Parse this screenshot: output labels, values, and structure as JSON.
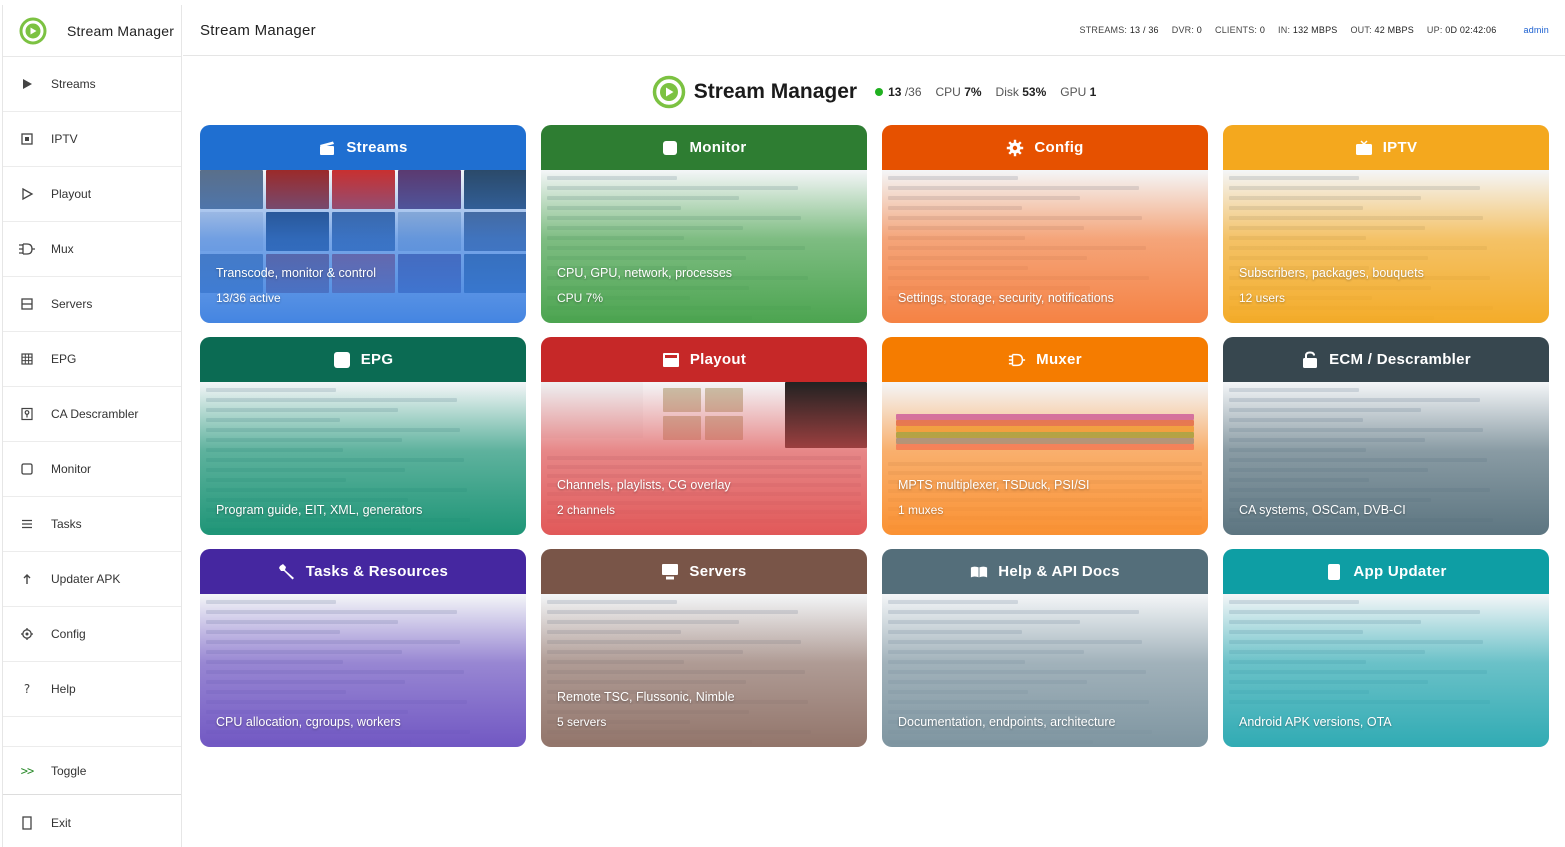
{
  "app": {
    "name": "Stream Manager",
    "page_title": "Stream Manager"
  },
  "sidebar": {
    "items": [
      {
        "label": "Streams",
        "icon": "play-icon"
      },
      {
        "label": "IPTV",
        "icon": "square-dot-icon"
      },
      {
        "label": "Playout",
        "icon": "play-outline-icon"
      },
      {
        "label": "Mux",
        "icon": "mux-icon"
      },
      {
        "label": "Servers",
        "icon": "server-icon"
      },
      {
        "label": "EPG",
        "icon": "grid-icon"
      },
      {
        "label": "CA Descrambler",
        "icon": "key-icon"
      },
      {
        "label": "Monitor",
        "icon": "monitor-icon"
      },
      {
        "label": "Tasks",
        "icon": "list-icon"
      },
      {
        "label": "Updater APK",
        "icon": "upload-icon"
      },
      {
        "label": "Config",
        "icon": "gear-icon"
      },
      {
        "label": "Help",
        "icon": "question-icon"
      }
    ],
    "toggle": {
      "label": "Toggle",
      "icon_text": ">>"
    },
    "exit": {
      "label": "Exit"
    }
  },
  "header": {
    "stats": [
      {
        "label": "STREAMS:",
        "value": "13 / 36"
      },
      {
        "label": "DVR:",
        "value": "0"
      },
      {
        "label": "CLIENTS:",
        "value": "0"
      },
      {
        "label": "IN:",
        "value": "132 MBPS"
      },
      {
        "label": "OUT:",
        "value": "42 MBPS"
      },
      {
        "label": "UP:",
        "value": "0D 02:42:06"
      }
    ],
    "user": "admin"
  },
  "hero": {
    "title": "Stream Manager",
    "active": "13",
    "total": "/36",
    "cpu_label": "CPU",
    "cpu_value": "7%",
    "disk_label": "Disk",
    "disk_value": "53%",
    "gpu_label": "GPU",
    "gpu_value": "1"
  },
  "cards": [
    {
      "title": "Streams",
      "desc": "Transcode, monitor & control",
      "sub": "13/36 active",
      "color": "#1f6fd1",
      "grad": "#3b7fe0",
      "icon": "clapper-icon"
    },
    {
      "title": "Monitor",
      "desc": "CPU, GPU, network, processes",
      "sub": "CPU 7%",
      "color": "#2e7d32",
      "grad": "#43a047",
      "icon": "monitor-icon"
    },
    {
      "title": "Config",
      "desc": "Settings, storage, security, notifications",
      "sub": "",
      "color": "#e65100",
      "grad": "#f57c3a",
      "icon": "gear-icon"
    },
    {
      "title": "IPTV",
      "desc": "Subscribers, packages, bouquets",
      "sub": "12 users",
      "color": "#f4a81e",
      "grad": "#f4a81e",
      "icon": "tv-icon"
    },
    {
      "title": "EPG",
      "desc": "Program guide, EIT, XML, generators",
      "sub": "",
      "color": "#0b6b53",
      "grad": "#139070",
      "icon": "calendar-icon"
    },
    {
      "title": "Playout",
      "desc": "Channels, playlists, CG overlay",
      "sub": "2 channels",
      "color": "#c62828",
      "grad": "#e05050",
      "icon": "film-icon"
    },
    {
      "title": "Muxer",
      "desc": "MPTS multiplexer, TSDuck, PSI/SI",
      "sub": "1 muxes",
      "color": "#f57c00",
      "grad": "#fb8c28",
      "icon": "mux-icon"
    },
    {
      "title": "ECM / Descrambler",
      "desc": "CA systems, OSCam, DVB-CI",
      "sub": "",
      "color": "#37474f",
      "grad": "#546e7a",
      "icon": "lock-icon"
    },
    {
      "title": "Tasks & Resources",
      "desc": "CPU allocation, cgroups, workers",
      "sub": "",
      "color": "#4527a0",
      "grad": "#6a4fc0",
      "icon": "wrench-icon"
    },
    {
      "title": "Servers",
      "desc": "Remote TSC, Flussonic, Nimble",
      "sub": "5 servers",
      "color": "#795548",
      "grad": "#8d6e63",
      "icon": "server-icon"
    },
    {
      "title": "Help & API Docs",
      "desc": "Documentation, endpoints, architecture",
      "sub": "",
      "color": "#546e7a",
      "grad": "#78909c",
      "icon": "book-icon"
    },
    {
      "title": "App Updater",
      "desc": "Android APK versions, OTA",
      "sub": "",
      "color": "#0e9ea4",
      "grad": "#26a7b0",
      "icon": "phone-icon"
    }
  ]
}
